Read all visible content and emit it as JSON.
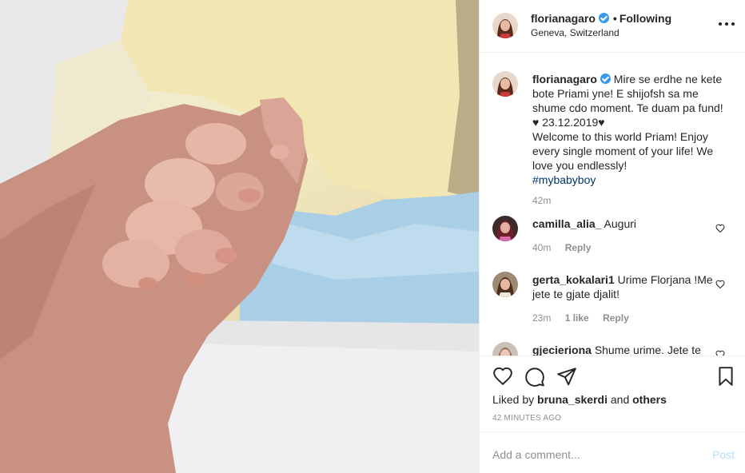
{
  "post": {
    "photo_alt": "baby hand holding adult finger",
    "author": {
      "username": "florianagaro",
      "verified": true,
      "follow_status": "Following",
      "separator": "•",
      "location": "Geneva, Switzerland"
    },
    "caption": {
      "username": "florianagaro",
      "line1": "Mire se erdhe ne kete bote Priami yne! E shijofsh sa me shume cdo moment. Te duam pa fund! ♥ 23.12.2019♥",
      "line2": "Welcome to this world Priam! Enjoy every single moment of your life! We love you endlessly!",
      "hashtag": "#mybabyboy",
      "time": "42m"
    },
    "comments": [
      {
        "username": "camilla_alia_",
        "text": "Auguri",
        "time": "40m",
        "likes": "",
        "reply": "Reply"
      },
      {
        "username": "gerta_kokalari1",
        "text": "Urime Florjana !Me jete te gjate djalit!",
        "time": "23m",
        "likes": "1 like",
        "reply": "Reply"
      },
      {
        "username": "gjecieriona",
        "text": "Shume urime. Jete te",
        "time": "",
        "likes": "",
        "reply": ""
      }
    ],
    "liked_by_prefix": "Liked by",
    "liked_by_user": "bruna_skerdi",
    "liked_by_and": "and",
    "liked_by_others": "others",
    "time_ago": "42 MINUTES AGO",
    "comment_placeholder": "Add a comment...",
    "post_button": "Post"
  },
  "icons": {
    "more": "more-options-icon",
    "like": "heart-icon",
    "comment": "comment-icon",
    "share": "share-icon",
    "save": "bookmark-icon"
  },
  "colors": {
    "verified": "#3897f0",
    "hashtag": "#003569",
    "muted": "#8e8e8e",
    "post_disabled": "#b2dffc"
  }
}
